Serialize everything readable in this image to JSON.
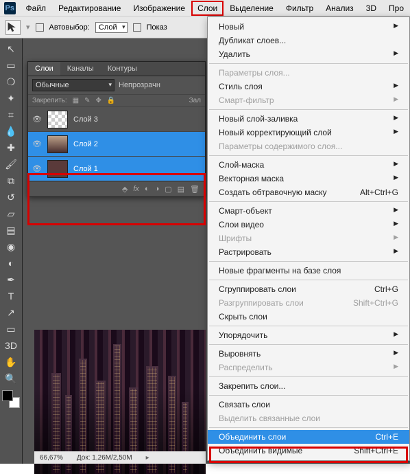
{
  "menu": {
    "items": [
      "Файл",
      "Редактирование",
      "Изображение",
      "Слои",
      "Выделение",
      "Фильтр",
      "Анализ",
      "3D",
      "Про"
    ],
    "active_index": 3,
    "logo": "Ps"
  },
  "options_bar": {
    "auto_select_label": "Автовыбор:",
    "auto_select_value": "Слой",
    "show_label": "Показ"
  },
  "layers_panel": {
    "tabs": [
      "Слои",
      "Каналы",
      "Контуры"
    ],
    "active_tab": 0,
    "blend_mode": "Обычные",
    "opacity_label": "Непрозрачн",
    "lock_label": "Закрепить:",
    "fill_label": "Зал",
    "layers": [
      {
        "name": "Слой 3",
        "selected": false,
        "thumb": "checker"
      },
      {
        "name": "Слой 2",
        "selected": true,
        "thumb": "image"
      },
      {
        "name": "Слой 1",
        "selected": true,
        "thumb": "solid"
      }
    ],
    "footer_icons": [
      "link",
      "fx",
      "mask",
      "adj",
      "group",
      "new",
      "trash"
    ]
  },
  "status_bar": {
    "zoom": "66,67%",
    "doc_info": "Док: 1,26M/2,50M"
  },
  "dropdown": {
    "groups": [
      [
        {
          "label": "Новый",
          "shortcut": "",
          "sub": true,
          "disabled": false
        },
        {
          "label": "Дубликат слоев...",
          "shortcut": "",
          "sub": false,
          "disabled": false
        },
        {
          "label": "Удалить",
          "shortcut": "",
          "sub": true,
          "disabled": false
        }
      ],
      [
        {
          "label": "Параметры слоя...",
          "shortcut": "",
          "sub": false,
          "disabled": true
        },
        {
          "label": "Стиль слоя",
          "shortcut": "",
          "sub": true,
          "disabled": false
        },
        {
          "label": "Смарт-фильтр",
          "shortcut": "",
          "sub": true,
          "disabled": true
        }
      ],
      [
        {
          "label": "Новый слой-заливка",
          "shortcut": "",
          "sub": true,
          "disabled": false
        },
        {
          "label": "Новый корректирующий слой",
          "shortcut": "",
          "sub": true,
          "disabled": false
        },
        {
          "label": "Параметры содержимого слоя...",
          "shortcut": "",
          "sub": false,
          "disabled": true
        }
      ],
      [
        {
          "label": "Слой-маска",
          "shortcut": "",
          "sub": true,
          "disabled": false
        },
        {
          "label": "Векторная маска",
          "shortcut": "",
          "sub": true,
          "disabled": false
        },
        {
          "label": "Создать обтравочную маску",
          "shortcut": "Alt+Ctrl+G",
          "sub": false,
          "disabled": false
        }
      ],
      [
        {
          "label": "Смарт-объект",
          "shortcut": "",
          "sub": true,
          "disabled": false
        },
        {
          "label": "Слои видео",
          "shortcut": "",
          "sub": true,
          "disabled": false
        },
        {
          "label": "Шрифты",
          "shortcut": "",
          "sub": true,
          "disabled": true
        },
        {
          "label": "Растрировать",
          "shortcut": "",
          "sub": true,
          "disabled": false
        }
      ],
      [
        {
          "label": "Новые фрагменты на базе слоя",
          "shortcut": "",
          "sub": false,
          "disabled": false
        }
      ],
      [
        {
          "label": "Сгруппировать слои",
          "shortcut": "Ctrl+G",
          "sub": false,
          "disabled": false
        },
        {
          "label": "Разгруппировать слои",
          "shortcut": "Shift+Ctrl+G",
          "sub": false,
          "disabled": true
        },
        {
          "label": "Скрыть слои",
          "shortcut": "",
          "sub": false,
          "disabled": false
        }
      ],
      [
        {
          "label": "Упорядочить",
          "shortcut": "",
          "sub": true,
          "disabled": false
        }
      ],
      [
        {
          "label": "Выровнять",
          "shortcut": "",
          "sub": true,
          "disabled": false
        },
        {
          "label": "Распределить",
          "shortcut": "",
          "sub": true,
          "disabled": true
        }
      ],
      [
        {
          "label": "Закрепить слои...",
          "shortcut": "",
          "sub": false,
          "disabled": false
        }
      ],
      [
        {
          "label": "Связать слои",
          "shortcut": "",
          "sub": false,
          "disabled": false
        },
        {
          "label": "Выделить связанные слои",
          "shortcut": "",
          "sub": false,
          "disabled": true
        }
      ],
      [
        {
          "label": "Объединить слои",
          "shortcut": "Ctrl+E",
          "sub": false,
          "disabled": false,
          "hover": true
        },
        {
          "label": "Объединить видимые",
          "shortcut": "Shift+Ctrl+E",
          "sub": false,
          "disabled": false
        }
      ]
    ]
  },
  "tools": [
    "move",
    "marquee",
    "lasso",
    "wand",
    "crop",
    "eyedrop",
    "heal",
    "brush",
    "stamp",
    "history",
    "eraser",
    "gradient",
    "blur",
    "dodge",
    "pen",
    "type",
    "path",
    "shape",
    "3d",
    "hand",
    "zoom"
  ]
}
